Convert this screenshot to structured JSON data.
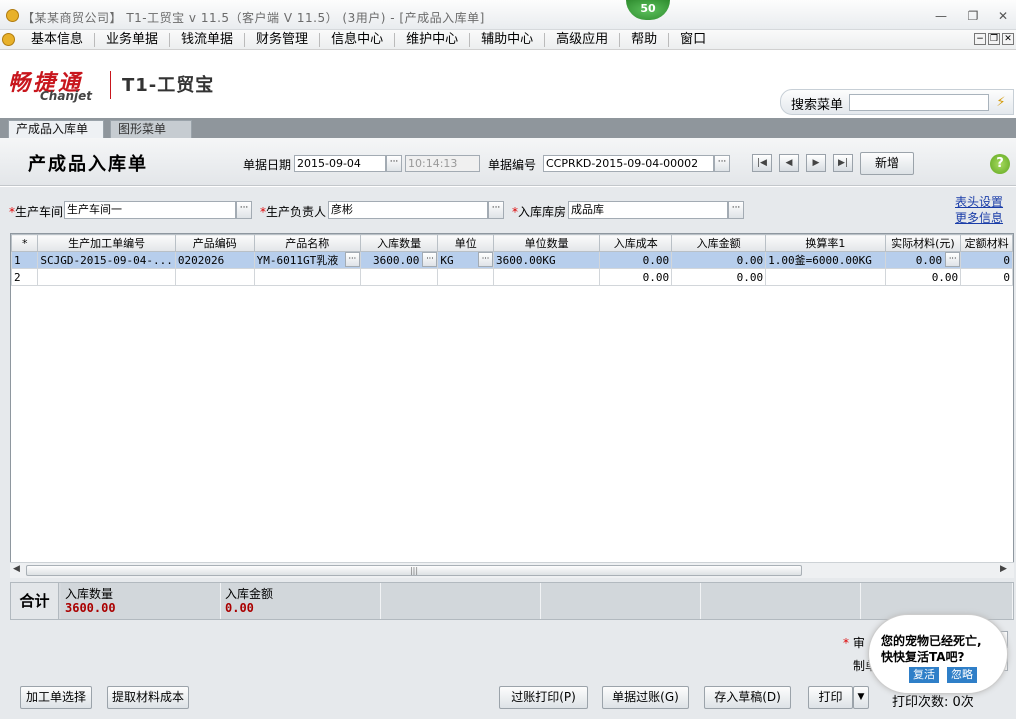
{
  "titlebar": {
    "title": "【某某商贸公司】 T1-工贸宝 v 11.5（客户端 V 11.5） (3用户) - [产成品入库单]",
    "badge": "50",
    "minimize": "—",
    "restore": "❐",
    "close": "✕"
  },
  "menubar": {
    "items": [
      "基本信息",
      "业务单据",
      "钱流单据",
      "财务管理",
      "信息中心",
      "维护中心",
      "辅助中心",
      "高级应用",
      "帮助",
      "窗口"
    ],
    "mdi_min": "−",
    "mdi_restore": "❐",
    "mdi_close": "✕"
  },
  "branding": {
    "logo_cn": "畅捷通",
    "logo_en": "Chanjet",
    "product": "T1-工贸宝"
  },
  "search": {
    "label": "搜索菜单",
    "value": "",
    "icon": "lightning-icon",
    "glyph": "⚡"
  },
  "tabs": [
    {
      "label": "产成品入库单",
      "active": true
    },
    {
      "label": "图形菜单",
      "active": false
    }
  ],
  "header": {
    "title": "产成品入库单",
    "date_label": "单据日期",
    "date_value": "2015-09-04",
    "time_value": "10:14:13",
    "number_label": "单据编号",
    "number_value": "CCPRKD-2015-09-04-00002",
    "nav_first": "|◀",
    "nav_prev": "◀",
    "nav_next": "▶",
    "nav_last": "▶|",
    "new_button": "新增",
    "help": "?"
  },
  "fields": {
    "workshop_label": "生产车间",
    "workshop_value": "生产车间一",
    "manager_label": "生产负责人",
    "manager_value": "彦彬",
    "warehouse_label": "入库库房",
    "warehouse_value": "成品库",
    "required_mark": "*",
    "dots": "···",
    "link_header_settings": "表头设置",
    "link_more_info": "更多信息"
  },
  "grid": {
    "corner": "*",
    "columns": [
      "生产加工单编号",
      "产品编码",
      "产品名称",
      "入库数量",
      "单位",
      "单位数量",
      "入库成本",
      "入库金额",
      "换算率1",
      "实际材料(元)",
      "定额材料"
    ],
    "rows": [
      [
        "1",
        "SCJGD-2015-09-04-...",
        "0202026",
        "YM-6011GT乳液",
        "3600.00",
        "KG",
        "3600.00KG",
        "0.00",
        "0.00",
        "1.00釜=6000.00KG",
        "0.00",
        "0"
      ],
      [
        "2",
        "",
        "",
        "",
        "",
        "",
        "",
        "0.00",
        "0.00",
        "",
        "0.00",
        "0"
      ]
    ],
    "scroll_left": "◀",
    "scroll_right": "▶",
    "thumb_grip": "|||"
  },
  "totals": {
    "label": "合计",
    "qty_label": "入库数量",
    "qty_value": "3600.00",
    "amount_label": "入库金额",
    "amount_value": "0.00"
  },
  "footer": {
    "audit_label": "审",
    "maker_label": "制单",
    "print_count_label": "打印次数:",
    "print_count_value": "0次",
    "buttons": {
      "select_order": "加工单选择",
      "fetch_cost": "提取材料成本",
      "post_print": "过账打印(P)",
      "post": "单据过账(G)",
      "save_draft": "存入草稿(D)",
      "print": "打印",
      "print_arrow": "▼"
    }
  },
  "pet_popup": {
    "line1": "您的宠物已经死亡,",
    "line2": "快快复活TA吧?",
    "revive": "复活",
    "ignore": "忽略"
  }
}
